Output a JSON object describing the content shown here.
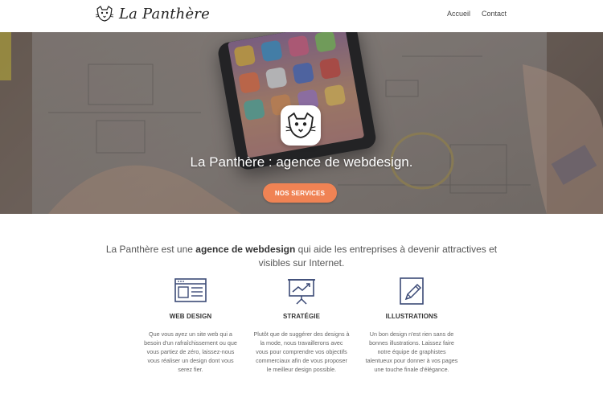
{
  "header": {
    "brand": "La Panthère",
    "nav": {
      "home": "Accueil",
      "contact": "Contact"
    }
  },
  "hero": {
    "title": "La Panthère : agence de webdesign.",
    "cta": "NOS SERVICES"
  },
  "intro": {
    "before": "La Panthère est une ",
    "bold": "agence de webdesign",
    "after": " qui aide les entreprises à devenir attractives et visibles sur Internet."
  },
  "services": [
    {
      "icon": "web-design-icon",
      "title": "WEB DESIGN",
      "description": "Que vous ayez un site web qui a besoin d'un rafraîchissement ou que vous partiez de zéro, laissez-nous vous réaliser un design dont vous serez fier."
    },
    {
      "icon": "presentation-chart-icon",
      "title": "STRATÉGIE",
      "description": "Plutôt que de suggérer des designs à la mode, nous travaillerons avec vous pour comprendre vos objectifs commerciaux afin de vous proposer le meilleur design possible."
    },
    {
      "icon": "pencil-icon",
      "title": "ILLUSTRATIONS",
      "description": "Un bon design n'est rien sans de bonnes illustrations. Laissez faire notre équipe de graphistes talentueux pour donner à vos pages une touche finale d'élégance."
    }
  ],
  "colors": {
    "accent": "#f08354",
    "icon_stroke": "#3b4a76"
  }
}
